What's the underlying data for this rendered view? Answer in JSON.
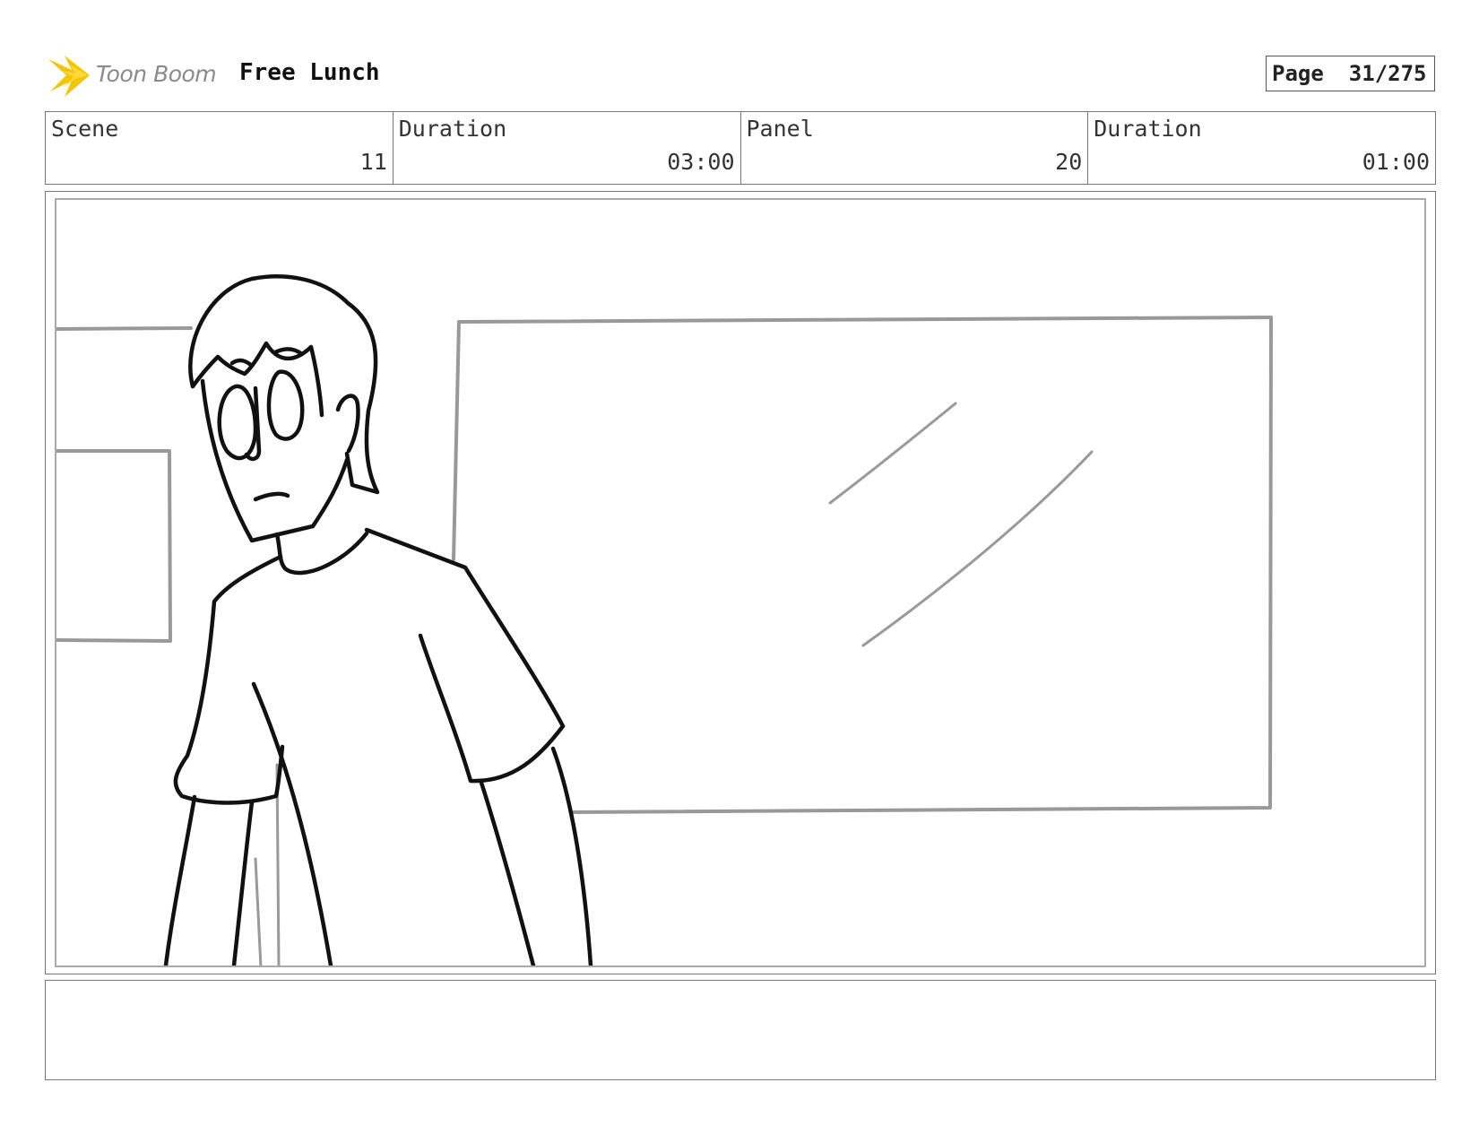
{
  "header": {
    "logo_text": "Toon Boom",
    "logo_icon": "toon-boom-star-icon",
    "project_title": "Free Lunch",
    "page_label": "Page",
    "page_value": "31/275"
  },
  "info": {
    "scene_label": "Scene",
    "scene_value": "11",
    "scene_duration_label": "Duration",
    "scene_duration_value": "03:00",
    "panel_label": "Panel",
    "panel_value": "20",
    "panel_duration_label": "Duration",
    "panel_duration_value": "01:00"
  },
  "panel": {
    "description": ""
  },
  "notes": {
    "text": ""
  },
  "colors": {
    "logo_accent": "#f5c400",
    "sketch_ink": "#111111",
    "background_lines": "#999999"
  }
}
